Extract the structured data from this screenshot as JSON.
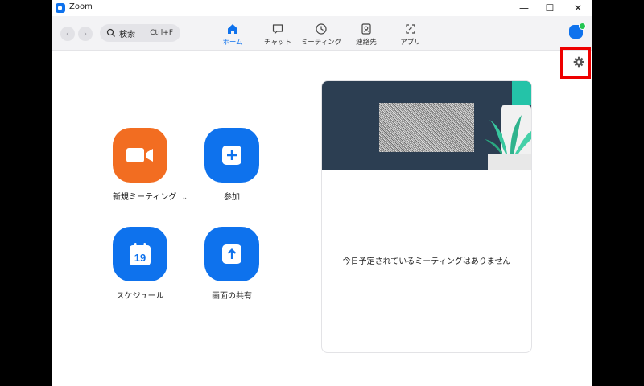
{
  "window": {
    "title": "Zoom",
    "controls": {
      "minimize": "—",
      "maximize": "☐",
      "close": "✕"
    }
  },
  "toolbar": {
    "back_glyph": "‹",
    "forward_glyph": "›",
    "search": {
      "label": "検索",
      "shortcut": "Ctrl+F"
    },
    "tabs": [
      {
        "label": "ホーム",
        "icon": "home-icon",
        "active": true
      },
      {
        "label": "チャット",
        "icon": "chat-icon",
        "active": false
      },
      {
        "label": "ミーティング",
        "icon": "clock-icon",
        "active": false
      },
      {
        "label": "連絡先",
        "icon": "contacts-icon",
        "active": false
      },
      {
        "label": "アプリ",
        "icon": "apps-icon",
        "active": false
      }
    ]
  },
  "actions": {
    "new_meeting": {
      "label": "新規ミーティング",
      "chevron": "⌄",
      "icon": "video-camera-icon",
      "color": "#F26D21"
    },
    "join": {
      "label": "参加",
      "icon": "plus-icon",
      "color": "#0E72ED"
    },
    "schedule": {
      "label": "スケジュール",
      "icon": "calendar-icon",
      "day": "19",
      "color": "#0E72ED"
    },
    "share_screen": {
      "label": "画面の共有",
      "icon": "upload-arrow-icon",
      "color": "#0E72ED"
    }
  },
  "meetings_panel": {
    "empty_message": "今日予定されているミーティングはありません"
  },
  "colors": {
    "accent": "#0E72ED",
    "orange": "#F26D21",
    "banner": "#2C3E52",
    "highlight": "#E00000"
  }
}
